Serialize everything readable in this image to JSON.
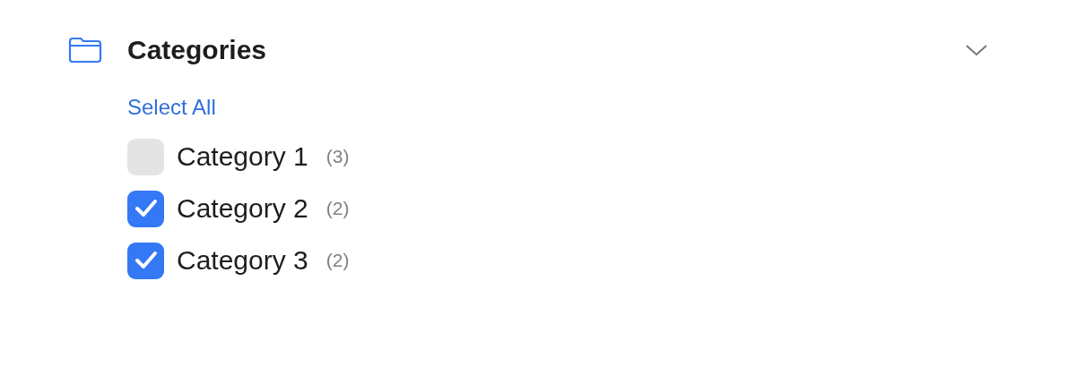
{
  "section": {
    "title": "Categories",
    "expanded": true,
    "select_all": "Select All",
    "items": [
      {
        "label": "Category 1",
        "count": "(3)",
        "checked": false
      },
      {
        "label": "Category 2",
        "count": "(2)",
        "checked": true
      },
      {
        "label": "Category 3",
        "count": "(2)",
        "checked": true
      }
    ]
  }
}
